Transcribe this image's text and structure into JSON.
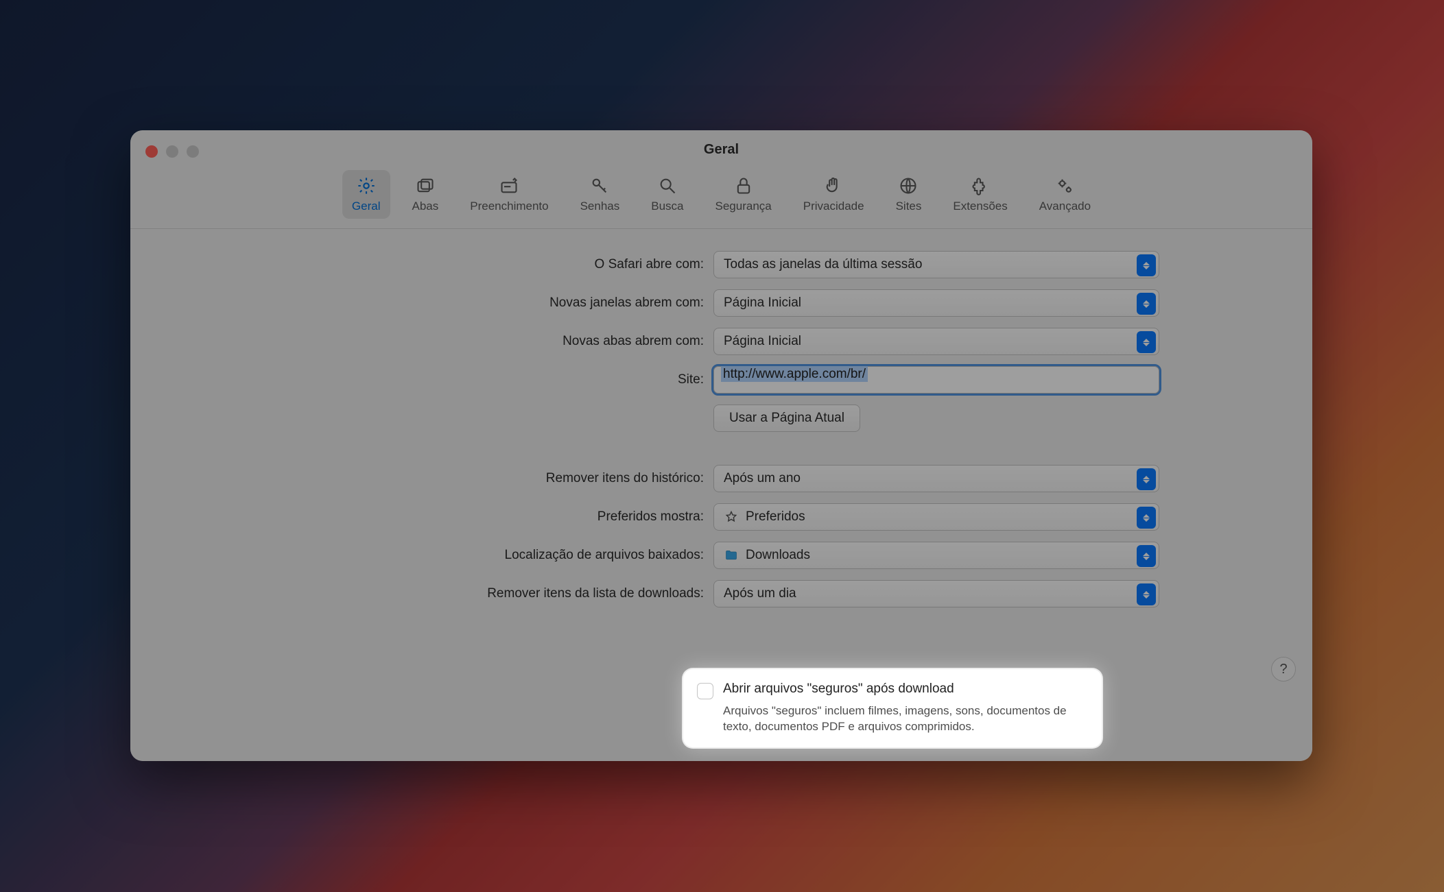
{
  "window": {
    "title": "Geral"
  },
  "toolbar": {
    "items": [
      {
        "id": "geral",
        "label": "Geral",
        "icon": "gear-icon",
        "active": true
      },
      {
        "id": "abas",
        "label": "Abas",
        "icon": "tabs-icon",
        "active": false
      },
      {
        "id": "preenchimento",
        "label": "Preenchimento",
        "icon": "autofill-icon",
        "active": false
      },
      {
        "id": "senhas",
        "label": "Senhas",
        "icon": "key-icon",
        "active": false
      },
      {
        "id": "busca",
        "label": "Busca",
        "icon": "search-icon",
        "active": false
      },
      {
        "id": "seguranca",
        "label": "Segurança",
        "icon": "lock-icon",
        "active": false
      },
      {
        "id": "privacidade",
        "label": "Privacidade",
        "icon": "hand-icon",
        "active": false
      },
      {
        "id": "sites",
        "label": "Sites",
        "icon": "globe-icon",
        "active": false
      },
      {
        "id": "extensoes",
        "label": "Extensões",
        "icon": "puzzle-icon",
        "active": false
      },
      {
        "id": "avancado",
        "label": "Avançado",
        "icon": "gears-icon",
        "active": false
      }
    ]
  },
  "general": {
    "opens_with_label": "O Safari abre com:",
    "opens_with_value": "Todas as janelas da última sessão",
    "new_windows_label": "Novas janelas abrem com:",
    "new_windows_value": "Página Inicial",
    "new_tabs_label": "Novas abas abrem com:",
    "new_tabs_value": "Página Inicial",
    "homepage_label": "Site:",
    "homepage_value": "http://www.apple.com/br/",
    "use_current_page_button": "Usar a Página Atual",
    "remove_history_label": "Remover itens do histórico:",
    "remove_history_value": "Após um ano",
    "favorites_label": "Preferidos mostra:",
    "favorites_value": "Preferidos",
    "download_location_label": "Localização de arquivos baixados:",
    "download_location_value": "Downloads",
    "remove_downloads_label": "Remover itens da lista de downloads:",
    "remove_downloads_value": "Após um dia",
    "safe_downloads_checkbox_label": "Abrir arquivos \"seguros\" após download",
    "safe_downloads_checkbox_checked": false,
    "safe_downloads_description": "Arquivos \"seguros\" incluem filmes, imagens, sons, documentos de texto, documentos PDF e arquivos comprimidos."
  },
  "help_button": "?"
}
